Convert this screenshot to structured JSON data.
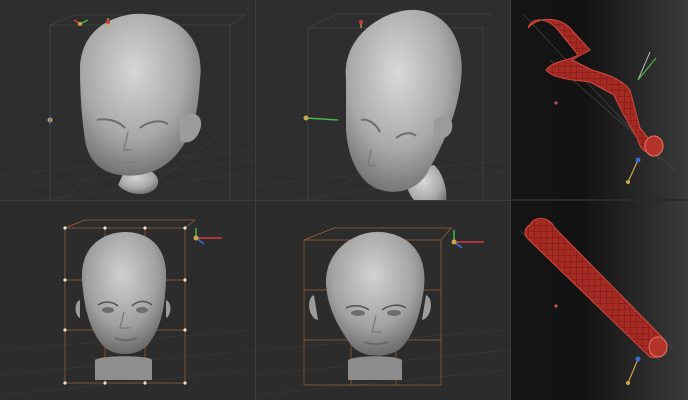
{
  "title": "",
  "viewports": [
    {
      "name": "stylized-head-front",
      "shaded": true
    },
    {
      "name": "stylized-head-deformed",
      "shaded": true
    },
    {
      "name": "realistic-head-with-cage",
      "shaded": true
    },
    {
      "name": "realistic-head-deformed-cage",
      "shaded": true
    },
    {
      "name": "tube-bent",
      "wireframe": true
    },
    {
      "name": "tube-straight",
      "wireframe": true
    }
  ],
  "colors": {
    "background": "#2e2e2e",
    "mesh": "#b9b9b9",
    "tube": "#b1302a",
    "cage": "#a0623a",
    "gizmo_x": "#d23a3a",
    "gizmo_y": "#45b64a",
    "gizmo_z": "#3d6bd6"
  },
  "icons": [
    "transform-gizmo-icon",
    "pivot-gizmo-icon"
  ]
}
